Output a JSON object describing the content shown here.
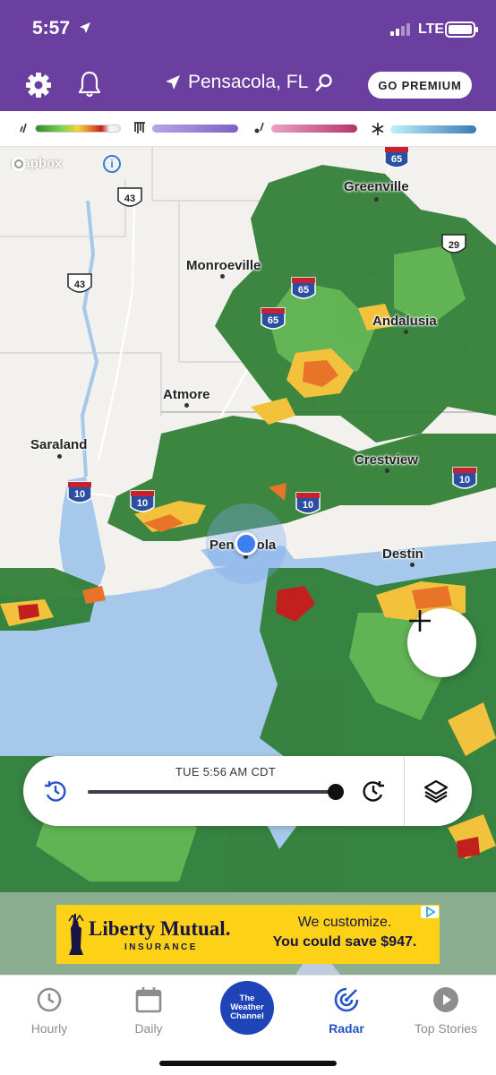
{
  "status_bar": {
    "time": "5:57",
    "network": "LTE"
  },
  "header": {
    "location": "Pensacola, FL",
    "premium_label": "GO PREMIUM"
  },
  "legend": {
    "items": [
      {
        "icon": "rain-icon",
        "colors": [
          "#2e8b2e",
          "#7cd34a",
          "#f2d43d",
          "#e8742a",
          "#c21f1f",
          "#e7e7e7"
        ]
      },
      {
        "icon": "freezing-rain-icon",
        "colors": [
          "#b9a4e6",
          "#7c62c7"
        ]
      },
      {
        "icon": "mix-icon",
        "colors": [
          "#e7a3c2",
          "#b8336a"
        ]
      },
      {
        "icon": "snow-icon",
        "colors": [
          "#bdf0f7",
          "#3b7ab7"
        ]
      }
    ]
  },
  "map": {
    "attribution": "mapbox",
    "cities": [
      {
        "name": "Greenville"
      },
      {
        "name": "Monroeville"
      },
      {
        "name": "Andalusia"
      },
      {
        "name": "Atmore"
      },
      {
        "name": "Saraland"
      },
      {
        "name": "Crestview"
      },
      {
        "name": "Pensacola"
      },
      {
        "name": "Destin"
      }
    ],
    "highway_shields": [
      {
        "label": "65",
        "type": "interstate"
      },
      {
        "label": "43",
        "type": "us"
      },
      {
        "label": "29",
        "type": "us"
      },
      {
        "label": "43",
        "type": "us"
      },
      {
        "label": "65",
        "type": "interstate"
      },
      {
        "label": "65",
        "type": "interstate"
      },
      {
        "label": "10",
        "type": "interstate"
      },
      {
        "label": "10",
        "type": "interstate"
      },
      {
        "label": "10",
        "type": "interstate"
      },
      {
        "label": "10",
        "type": "interstate"
      }
    ]
  },
  "timeline": {
    "timestamp": "TUE 5:56 AM CDT",
    "progress": 1.0
  },
  "ad": {
    "brand": "Liberty Mutual.",
    "subbrand": "INSURANCE",
    "line1": "We customize.",
    "line2": "You could save $947."
  },
  "bottom_nav": {
    "items": [
      {
        "label": "Hourly"
      },
      {
        "label": "Daily"
      },
      {
        "label": "Radar"
      },
      {
        "label": "Top Stories"
      }
    ],
    "logo_lines": [
      "The",
      "Weather",
      "Channel"
    ],
    "active": "Radar"
  },
  "colors": {
    "brand_purple": "#6b3fa0",
    "active_blue": "#2554c7",
    "water": "#a6c8ea",
    "ad_yellow": "#fcd116"
  }
}
